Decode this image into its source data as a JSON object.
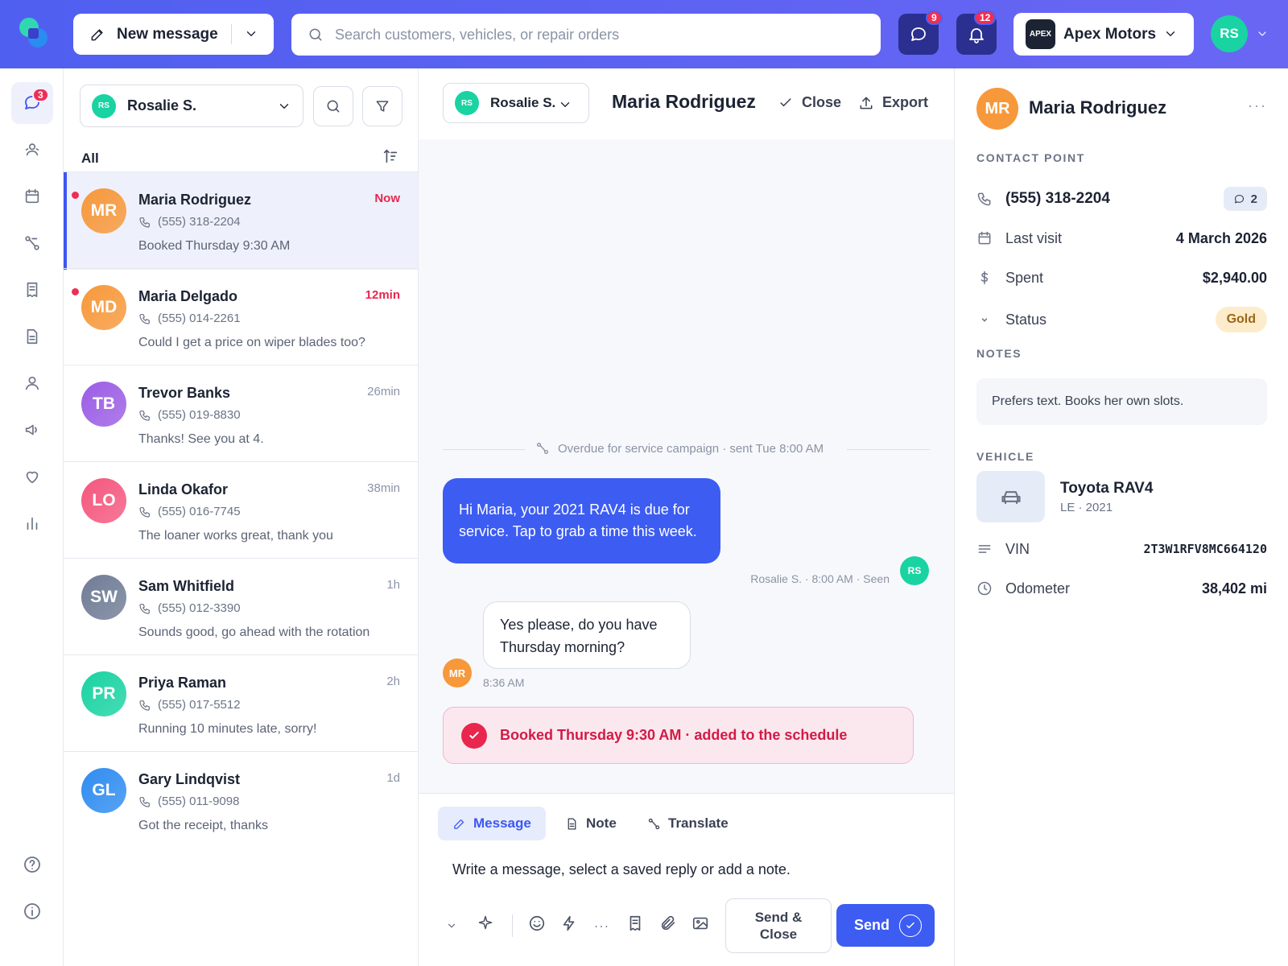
{
  "topbar": {
    "new_message_label": "New message",
    "search_placeholder": "Search customers, vehicles, or repair orders",
    "messages_badge": "9",
    "notifications_badge": "12",
    "shop_logo_text": "APEX",
    "shop_name": "Apex Motors",
    "user_initials": "RS"
  },
  "rail": {
    "inbox_badge": "3",
    "icons": [
      "chat-icon",
      "customers-icon",
      "calendar-icon",
      "workflow-icon",
      "receipt-icon",
      "document-icon",
      "user-icon",
      "megaphone-icon",
      "heart-icon",
      "chart-icon",
      "help-icon",
      "info-icon"
    ]
  },
  "list": {
    "agent_initials": "RS",
    "agent_name": "Rosalie S.",
    "filter_label": "All",
    "conversations": [
      {
        "initials": "MR",
        "name": "Maria Rodriguez",
        "time": "Now",
        "phone": "(555) 318-2204",
        "preview": "Booked Thursday 9:30 AM",
        "unread": true,
        "color": "#f7983a"
      },
      {
        "initials": "MD",
        "name": "Maria Delgado",
        "time": "12min",
        "phone": "(555) 014-2261",
        "preview": "Could I get a price on wiper blades too?",
        "unread": true,
        "color": "#f7983a"
      },
      {
        "initials": "TB",
        "name": "Trevor Banks",
        "time": "26min",
        "phone": "(555) 019-8830",
        "preview": "Thanks! See you at 4.",
        "unread": false,
        "color": "#9b5de5"
      },
      {
        "initials": "LO",
        "name": "Linda Okafor",
        "time": "38min",
        "phone": "(555) 016-7745",
        "preview": "The loaner works great, thank you",
        "unread": false,
        "color": "#f4577e"
      },
      {
        "initials": "SW",
        "name": "Sam Whitfield",
        "time": "1h",
        "phone": "(555) 012-3390",
        "preview": "Sounds good, go ahead with the rotation",
        "unread": false,
        "color": "#6f7c95"
      },
      {
        "initials": "PR",
        "name": "Priya Raman",
        "time": "2h",
        "phone": "(555) 017-5512",
        "preview": "Running 10 minutes late, sorry!",
        "unread": false,
        "color": "#19d3a2"
      },
      {
        "initials": "GL",
        "name": "Gary Lindqvist",
        "time": "1d",
        "phone": "(555) 011-9098",
        "preview": "Got the receipt, thanks",
        "unread": false,
        "color": "#2f8cf0"
      }
    ]
  },
  "chat": {
    "assignee_initials": "RS",
    "assignee_name": "Rosalie S.",
    "title": "Maria Rodriguez",
    "close_label": "Close",
    "export_label": "Export",
    "campaign_text": "Overdue for service campaign · sent Tue 8:00 AM",
    "outgoing_text": "Hi Maria, your 2021 RAV4 is due for service. Tap to grab a time this week.",
    "outgoing_meta": "Rosalie S. · 8:00 AM · Seen",
    "outgoing_initials": "RS",
    "incoming_text": "Yes please, do you have Thursday morning?",
    "incoming_initials": "MR",
    "incoming_meta": "8:36 AM",
    "booked_text": "Booked Thursday 9:30 AM · added to the schedule"
  },
  "composer": {
    "tabs": [
      "Message",
      "Note",
      "Translate"
    ],
    "active_tab": "Message",
    "placeholder": "Write a message, select a saved reply or add a note.",
    "send_close_label": "Send & Close",
    "send_label": "Send"
  },
  "detail": {
    "initials": "MR",
    "name": "Maria Rodriguez",
    "contact_heading": "CONTACT POINT",
    "phone": "(555) 318-2204",
    "conversation_count": "2",
    "last_visit_label": "Last visit",
    "last_visit_value": "4 March 2026",
    "spent_label": "Spent",
    "spent_value": "$2,940.00",
    "status_label": "Status",
    "status_value": "Gold",
    "notes_heading": "NOTES",
    "notes_text": "Prefers text. Books her own slots.",
    "vehicle_heading": "VEHICLE",
    "vehicle_name": "Toyota RAV4",
    "vehicle_sub": "LE · 2021",
    "vin_label": "VIN",
    "vin_value": "2T3W1RFV8MC664120",
    "odometer_label": "Odometer",
    "odometer_value": "38,402 mi"
  },
  "colors": {
    "brand": "#4f5ff0",
    "accent": "#3c5cf2",
    "alert": "#e8264e",
    "gold_bg": "#fdeccc"
  }
}
